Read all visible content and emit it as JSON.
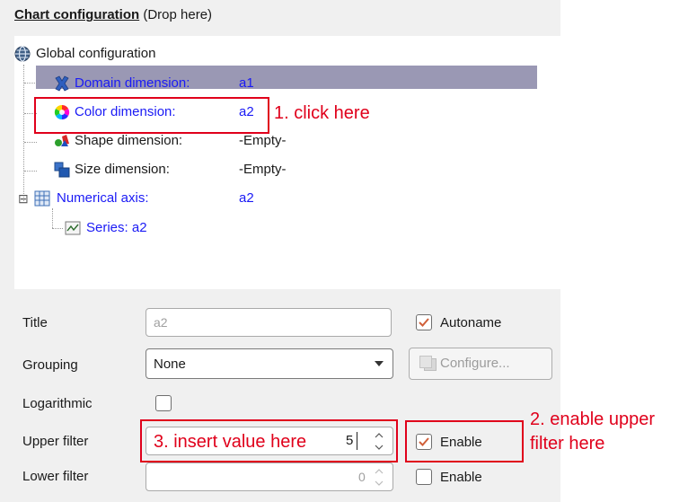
{
  "panel": {
    "title_bold": "Chart configuration",
    "title_rest": " (Drop here)"
  },
  "tree": {
    "root": "Global configuration",
    "items": [
      {
        "label": "Domain dimension:",
        "value": "a1"
      },
      {
        "label": "Color dimension:",
        "value": "a2"
      },
      {
        "label": "Shape dimension:",
        "value": "-Empty-"
      },
      {
        "label": "Size dimension:",
        "value": "-Empty-"
      },
      {
        "label": "Numerical axis:",
        "value": "a2"
      }
    ],
    "series": "Series: a2",
    "expander": "⊟"
  },
  "form": {
    "title_label": "Title",
    "title_value": "a2",
    "autoname_label": "Autoname",
    "grouping_label": "Grouping",
    "grouping_value": "None",
    "configure_label": "Configure...",
    "logarithmic_label": "Logarithmic",
    "upper_filter_label": "Upper filter",
    "upper_filter_value": "5",
    "lower_filter_label": "Lower filter",
    "lower_filter_value": "0",
    "enable_label": "Enable"
  },
  "annotations": {
    "step1": "1. click here",
    "step2_line1": "2. enable upper",
    "step2_line2": "filter here",
    "step3": "3. insert value here"
  },
  "colors": {
    "annotation_red": "#e0001b",
    "selection": "#9a98b4",
    "link_blue": "#1a1af5"
  }
}
